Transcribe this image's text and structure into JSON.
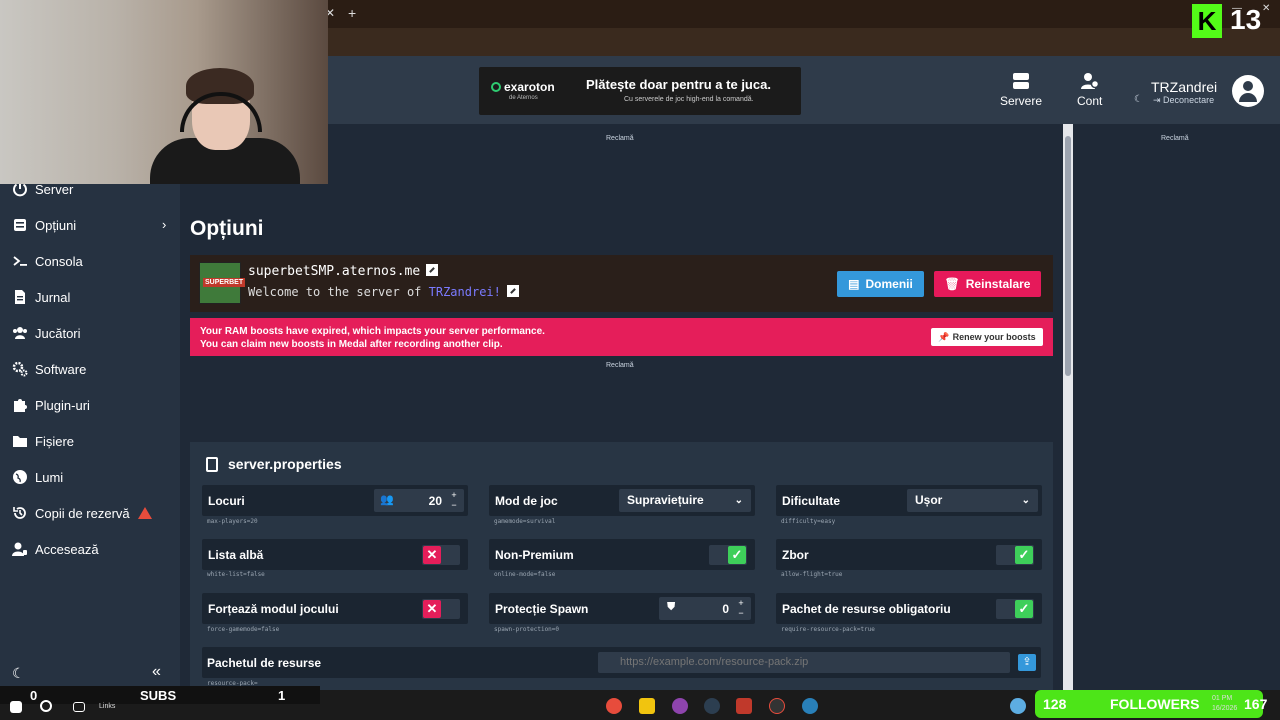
{
  "header": {
    "banner": {
      "brand": "exaroton",
      "brand_sub": "de Aternos",
      "title": "Plătește doar pentru a te juca.",
      "tagline": "Cu serverele de joc high-end la comandă."
    },
    "servers_label": "Servere",
    "account_label": "Cont",
    "username": "TRZandrei",
    "logout_label": "Deconectare"
  },
  "sidebar": {
    "items": [
      {
        "label": "Server",
        "icon": "power-icon"
      },
      {
        "label": "Opțiuni",
        "icon": "options-icon"
      },
      {
        "label": "Consola",
        "icon": "terminal-icon"
      },
      {
        "label": "Jurnal",
        "icon": "log-icon"
      },
      {
        "label": "Jucători",
        "icon": "players-icon"
      },
      {
        "label": "Software",
        "icon": "gears-icon"
      },
      {
        "label": "Plugin-uri",
        "icon": "puzzle-icon"
      },
      {
        "label": "Fișiere",
        "icon": "folder-icon"
      },
      {
        "label": "Lumi",
        "icon": "globe-icon"
      },
      {
        "label": "Copii de rezervă",
        "icon": "history-icon"
      },
      {
        "label": "Accesează",
        "icon": "user-key-icon"
      }
    ]
  },
  "ads": {
    "label": "Reclamă"
  },
  "page": {
    "title": "Opțiuni"
  },
  "server": {
    "address": "superbetSMP.aternos.me",
    "motd_prefix": "Welcome to the server of ",
    "motd_name": "TRZandrei",
    "motd_suffix": "!",
    "icon_text": "SUPERBET",
    "domains_button": "Domenii",
    "reinstall_button": "Reinstalare"
  },
  "alert": {
    "line1": "Your RAM boosts have expired, which impacts your server performance.",
    "line2": "You can claim new boosts in Medal after recording another clip.",
    "button": "Renew your boosts"
  },
  "properties": {
    "title": "server.properties",
    "fields": {
      "max_players": {
        "label": "Locuri",
        "value": "20",
        "key": "max-players=20"
      },
      "gamemode": {
        "label": "Mod de joc",
        "value": "Supraviețuire",
        "key": "gamemode=survival"
      },
      "difficulty": {
        "label": "Dificultate",
        "value": "Ușor",
        "key": "difficulty=easy"
      },
      "white_list": {
        "label": "Lista albă",
        "state": false,
        "key": "white-list=false"
      },
      "online_mode": {
        "label": "Non-Premium",
        "state": true,
        "key": "online-mode=false"
      },
      "allow_flight": {
        "label": "Zbor",
        "state": true,
        "key": "allow-flight=true"
      },
      "force_gamemode": {
        "label": "Forțează modul jocului",
        "state": false,
        "key": "force-gamemode=false"
      },
      "spawn_protection": {
        "label": "Protecție Spawn",
        "value": "0",
        "key": "spawn-protection=0"
      },
      "require_resource_pack": {
        "label": "Pachet de resurse obligatoriu",
        "state": true,
        "key": "require-resource-pack=true"
      },
      "resource_pack": {
        "label": "Pachetul de resurse",
        "placeholder": "https://example.com/resource-pack.zip",
        "key": "resource-pack="
      }
    }
  },
  "overlay": {
    "kick_count": "13",
    "subs_left": "0",
    "subs_label": "SUBS",
    "subs_right": "1",
    "followers_count": "128",
    "followers_label": "FOLLOWERS",
    "followers_goal": "167",
    "taskbar_links": "Links",
    "clock_time": "01 PM",
    "clock_date": "16/2026"
  },
  "colors": {
    "accent_blue": "#3498db",
    "accent_red": "#e6195a",
    "toggle_on": "#3ecf5a",
    "kick_green": "#53fc18"
  }
}
